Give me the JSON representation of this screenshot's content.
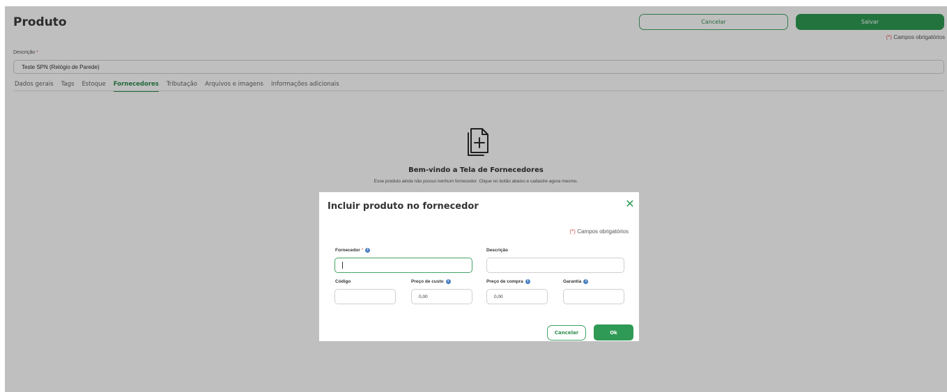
{
  "header": {
    "title": "Produto",
    "cancel_label": "Cancelar",
    "save_label": "Salvar",
    "required_star": "(*)",
    "required_note": "Campos obrigatórios"
  },
  "description": {
    "label": "Descrição",
    "star": "*",
    "value": "Teste SPN (Relógio de Parede)"
  },
  "tabs": [
    {
      "label": "Dados gerais",
      "active": false
    },
    {
      "label": "Tags",
      "active": false
    },
    {
      "label": "Estoque",
      "active": false
    },
    {
      "label": "Fornecedores",
      "active": true
    },
    {
      "label": "Tributação",
      "active": false
    },
    {
      "label": "Arquivos e imagens",
      "active": false
    },
    {
      "label": "Informações adicionais",
      "active": false
    }
  ],
  "empty_state": {
    "icon": "file-plus-icon",
    "title": "Bem-vindo a Tela de Fornecedores",
    "text": "Esse produto ainda não possui nenhum fornecedor. Clique no botão abaixo e cadastre agora mesmo."
  },
  "modal": {
    "title": "Incluir produto no fornecedor",
    "close_icon": "close-icon",
    "required_star": "(*)",
    "required_note": "Campos obrigatórios",
    "fields": {
      "fornecedor": {
        "label": "Fornecedor",
        "star": "*",
        "value": ""
      },
      "descricao": {
        "label": "Descrição",
        "value": ""
      },
      "codigo": {
        "label": "Código",
        "value": ""
      },
      "preco_custo": {
        "label": "Preço de custo",
        "value": "0,00"
      },
      "preco_compra": {
        "label": "Preço de compra",
        "value": "0,00"
      },
      "garantia": {
        "label": "Garantia",
        "value": ""
      }
    },
    "cancel_label": "Cancelar",
    "ok_label": "Ok"
  },
  "colors": {
    "accent": "#2f9a55",
    "required": "#d9534f",
    "info": "#4a7fc1"
  }
}
